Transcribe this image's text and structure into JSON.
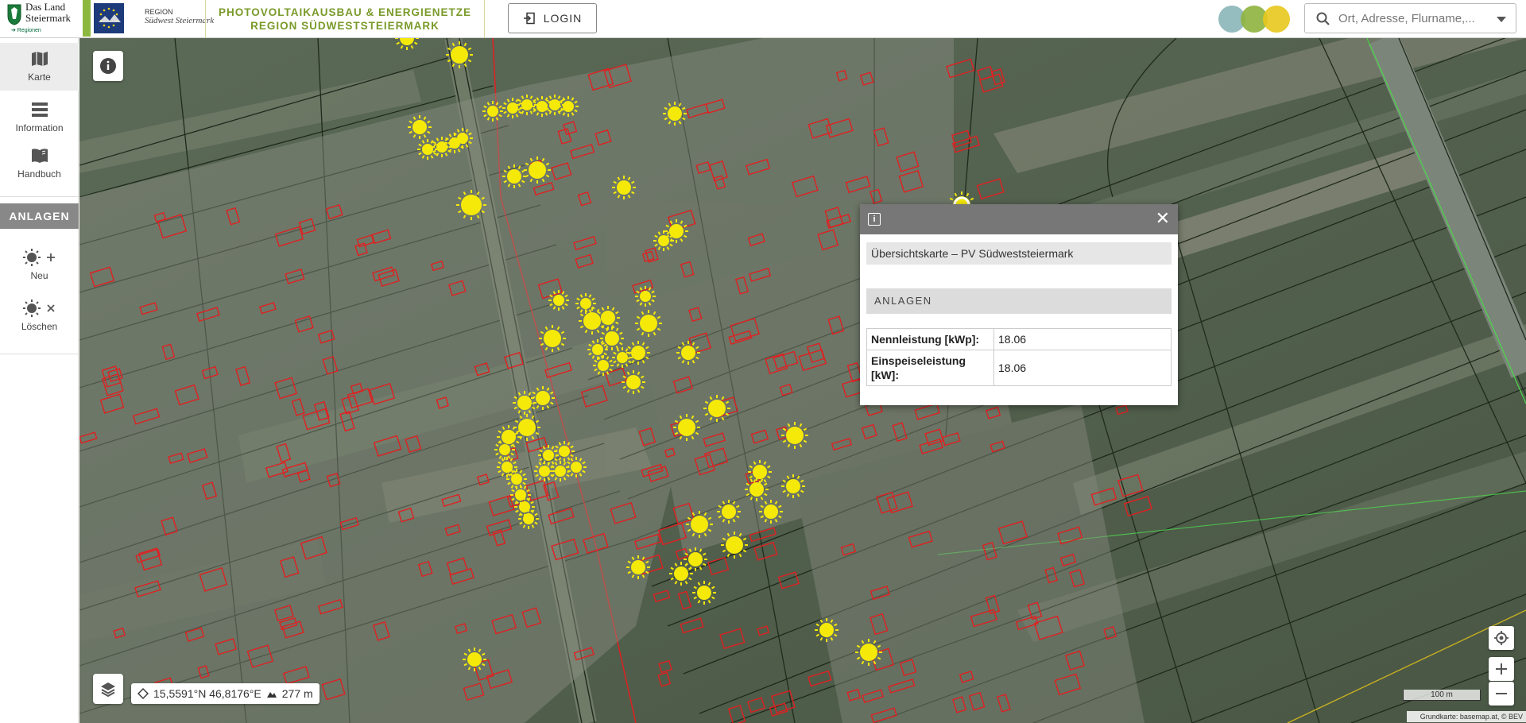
{
  "header": {
    "stmk_logo_line1": "Das Land",
    "stmk_logo_line2": "Steiermark",
    "stmk_logo_sub": "➔ Regionen",
    "region_logo_line1": "REGION",
    "region_logo_line2": "Südwest Steiermark",
    "title_line1": "PHOTOVOLTAIKAUSBAU & ENERGIENETZE",
    "title_line2": "REGION SÜDWESTSTEIERMARK",
    "login_label": "LOGIN",
    "search_placeholder": "Ort, Adresse, Flurname,..."
  },
  "sidebar": {
    "items": [
      {
        "label": "Karte",
        "icon": "map-icon",
        "active": true
      },
      {
        "label": "Information",
        "icon": "list-icon",
        "active": false
      },
      {
        "label": "Handbuch",
        "icon": "book-icon",
        "active": false
      }
    ],
    "section_label": "ANLAGEN",
    "actions": [
      {
        "label": "Neu",
        "icon": "sun-add-icon"
      },
      {
        "label": "Löschen",
        "icon": "sun-delete-icon"
      }
    ]
  },
  "map": {
    "coordinates": "15,5591°N 46,8176°E",
    "elevation": "277 m",
    "scale_label": "100 m",
    "attribution": "Grundkarte: basemap.at, © BEV"
  },
  "popup": {
    "title": "Übersichtskarte – PV Südweststeiermark",
    "section": "ANLAGEN",
    "rows": [
      {
        "key": "Nennleistung [kWp]:",
        "value": "18.06"
      },
      {
        "key": "Einspeiseleistung [kW]:",
        "value": "18.06"
      }
    ]
  },
  "colors": {
    "title_green": "#7a9a2a",
    "accent_green": "#8cb83f",
    "sun_yellow": "#f5e90a",
    "building_red": "#e02020",
    "parcel_line": "#1f2a1c"
  }
}
